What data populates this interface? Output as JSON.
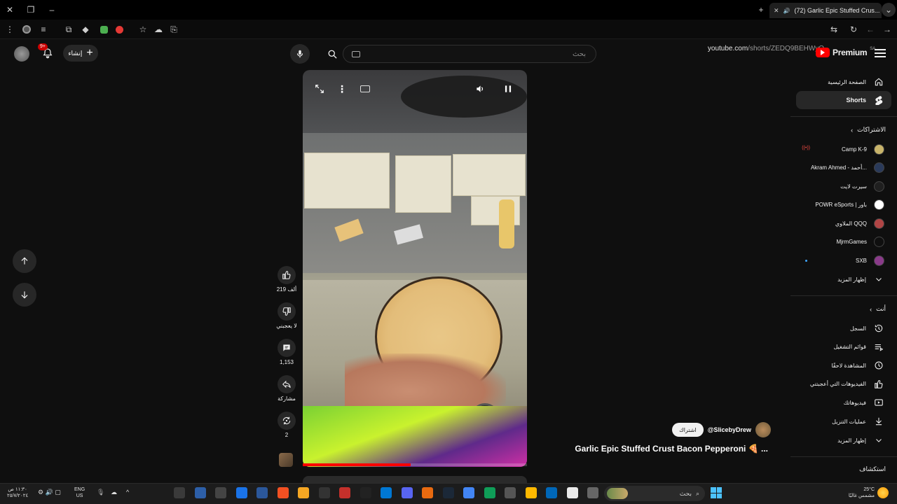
{
  "browser": {
    "tab_title": "(72) Garlic Epic Stuffed Crus...",
    "url_domain": "youtube.com",
    "url_path": "/shorts/ZEDQ9BEHWyQ"
  },
  "header": {
    "brand": "Premium",
    "brand_sup": "SA",
    "search_placeholder": "بحث",
    "create_label": "إنشاء",
    "notification_count": "9+"
  },
  "short": {
    "likes": "219 ألف",
    "dislike_label": "لا يعجبني",
    "comments": "1,153",
    "share_label": "مشاركة",
    "remix_count": "2",
    "channel": "@SlicebyDrew",
    "subscribe_label": "اشتراك",
    "title": "Garlic Epic Stuffed Crust Bacon Pepperoni 🍕 ...",
    "progress_percent": 48
  },
  "sidebar": {
    "home": "الصفحة الرئيسية",
    "shorts": "Shorts",
    "subscriptions_header": "الاشتراكات",
    "subscriptions": [
      {
        "name": "Camp K-9",
        "color": "#c8b46a",
        "live": true
      },
      {
        "name": "Akram Ahmed - أحمد...",
        "color": "#2a3a5a"
      },
      {
        "name": "سيرت لايت",
        "color": "#1f1f1f"
      },
      {
        "name": "POWR eSports | باور",
        "color": "#ffffff"
      },
      {
        "name": "الملاوي QQQ",
        "color": "#b04545"
      },
      {
        "name": "MjrmGames",
        "color": "#0f0f0f"
      },
      {
        "name": "SXB",
        "color": "#8a3a8a",
        "new": true
      }
    ],
    "show_more": "إظهار المزيد",
    "you_header": "أنت",
    "you_items": [
      {
        "label": "السجل",
        "icon": "history-icon"
      },
      {
        "label": "قوائم التشغيل",
        "icon": "playlist-icon"
      },
      {
        "label": "المشاهدة لاحقًا",
        "icon": "watch-later-icon"
      },
      {
        "label": "الفيديوهات التي أعجبتني",
        "icon": "liked-videos-icon"
      },
      {
        "label": "فيديوهاتك",
        "icon": "your-videos-icon"
      },
      {
        "label": "عمليات التنزيل",
        "icon": "downloads-icon"
      }
    ],
    "show_more_2": "إظهار المزيد",
    "explore_header": "استكشاف"
  },
  "taskbar": {
    "search_label": "بحث",
    "lang_line1": "ENG",
    "lang_line2": "US",
    "time": "١١:٣٠ ص",
    "date": "٢٥/٧/٢٠٢٤",
    "weather_temp": "25°C",
    "weather_desc": "مشمس غالبًا"
  }
}
